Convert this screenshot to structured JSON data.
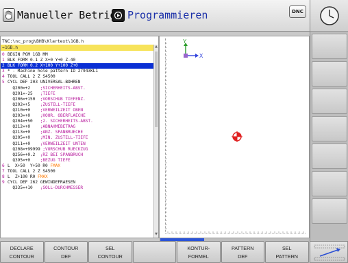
{
  "header": {
    "mode_left": "Manueller Betrieb",
    "mode_right": "Programmieren",
    "dnc_label": "DNC"
  },
  "program": {
    "path": "TNC:\\nc_prog\\BHB\\Klartext\\1GB.h",
    "file": "→1GB.h",
    "lines": [
      {
        "n": "0",
        "t": [
          {
            "c": "c",
            "s": "BEGIN PGM 1GB MM"
          }
        ]
      },
      {
        "n": "1",
        "t": [
          {
            "c": "c",
            "s": "BLK FORM 0.1 Z X+0 Y+0 Z-40"
          }
        ]
      },
      {
        "n": "2",
        "sel": true,
        "t": [
          {
            "c": "c",
            "s": "BLK FORM 0.2 X+100 Y+100 Z+0"
          }
        ]
      },
      {
        "n": "3",
        "t": [
          {
            "c": "c",
            "s": "* - Machine hole pattern ID 27943KL1"
          }
        ]
      },
      {
        "n": "4",
        "t": [
          {
            "c": "c",
            "s": "TOOL CALL 2 Z S4500"
          }
        ]
      },
      {
        "n": "5",
        "t": [
          {
            "c": "c",
            "s": "CYCL DEF 203 UNIVERSAL-BOHREN"
          }
        ]
      },
      {
        "n": "",
        "t": [
          {
            "c": "c",
            "s": "  Q200=+2    "
          },
          {
            "c": "p",
            "s": ";SICHERHEITS-ABST."
          }
        ]
      },
      {
        "n": "",
        "t": [
          {
            "c": "c",
            "s": "  Q201=-25   "
          },
          {
            "c": "p",
            "s": ";TIEFE"
          }
        ]
      },
      {
        "n": "",
        "t": [
          {
            "c": "c",
            "s": "  Q206=+150  "
          },
          {
            "c": "p",
            "s": ";VORSCHUB TIEFENZ."
          }
        ]
      },
      {
        "n": "",
        "t": [
          {
            "c": "c",
            "s": "  Q202=+5    "
          },
          {
            "c": "p",
            "s": ";ZUSTELL-TIEFE"
          }
        ]
      },
      {
        "n": "",
        "t": [
          {
            "c": "c",
            "s": "  Q210=+0    "
          },
          {
            "c": "p",
            "s": ";VERWEILZEIT OBEN"
          }
        ]
      },
      {
        "n": "",
        "t": [
          {
            "c": "c",
            "s": "  Q203=+0    "
          },
          {
            "c": "p",
            "s": ";KOOR. OBERFLAECHE"
          }
        ]
      },
      {
        "n": "",
        "t": [
          {
            "c": "c",
            "s": "  Q204=+50   "
          },
          {
            "c": "p",
            "s": ";2. SICHERHEITS-ABST."
          }
        ]
      },
      {
        "n": "",
        "t": [
          {
            "c": "c",
            "s": "  Q212=+0    "
          },
          {
            "c": "p",
            "s": ";ABNAHMEBETRAG"
          }
        ]
      },
      {
        "n": "",
        "t": [
          {
            "c": "c",
            "s": "  Q213=+0    "
          },
          {
            "c": "p",
            "s": ";ANZ. SPANBRUECHE"
          }
        ]
      },
      {
        "n": "",
        "t": [
          {
            "c": "c",
            "s": "  Q205=+0    "
          },
          {
            "c": "p",
            "s": ";MIN. ZUSTELL-TIEFE"
          }
        ]
      },
      {
        "n": "",
        "t": [
          {
            "c": "c",
            "s": "  Q211=+0    "
          },
          {
            "c": "p",
            "s": ";VERWEILZEIT UNTEN"
          }
        ]
      },
      {
        "n": "",
        "t": [
          {
            "c": "c",
            "s": "  Q208=+99999 "
          },
          {
            "c": "p",
            "s": ";VORSCHUB RUECKZUG"
          }
        ]
      },
      {
        "n": "",
        "t": [
          {
            "c": "c",
            "s": "  Q256=+0.2  "
          },
          {
            "c": "p",
            "s": ";RZ BEI SPANBRUCH"
          }
        ]
      },
      {
        "n": "",
        "t": [
          {
            "c": "c",
            "s": "  Q395=+0    "
          },
          {
            "c": "p",
            "s": ";BEZUG TIEFE"
          }
        ]
      },
      {
        "n": "6",
        "t": [
          {
            "c": "c",
            "s": "L  X+50  Y+50 R0 "
          },
          {
            "c": "o",
            "s": "FMAX"
          }
        ]
      },
      {
        "n": "7",
        "t": [
          {
            "c": "c",
            "s": "TOOL CALL 2 Z S4500"
          }
        ]
      },
      {
        "n": "8",
        "t": [
          {
            "c": "c",
            "s": "L  Z+100 R0 "
          },
          {
            "c": "o",
            "s": "FMAX"
          }
        ]
      },
      {
        "n": "9",
        "t": [
          {
            "c": "c",
            "s": "CYCL DEF 262 GEWINDEFRAESEN"
          }
        ]
      },
      {
        "n": "",
        "t": [
          {
            "c": "c",
            "s": "  Q335=+10   "
          },
          {
            "c": "p",
            "s": ";SOLL-DURCHMESSER"
          }
        ]
      }
    ]
  },
  "graphics": {
    "axis_y": "Y",
    "axis_x": "X",
    "axis_y_color": "#2a9d2a",
    "axis_x_color": "#3344dd",
    "target_color": "#e02020"
  },
  "softkeys": [
    {
      "l1": "DECLARE",
      "l2": "CONTOUR"
    },
    {
      "l1": "CONTOUR",
      "l2": "DEF"
    },
    {
      "l1": "SEL",
      "l2": "CONTOUR"
    },
    {
      "l1": "",
      "l2": ""
    },
    {
      "l1": "KONTUR-",
      "l2": "FORMEL"
    },
    {
      "l1": "PATTERN",
      "l2": "DEF"
    },
    {
      "l1": "SEL",
      "l2": "PATTERN"
    }
  ],
  "colors": {
    "selection": "#0a2fd4",
    "file_bar": "#f7e35a",
    "numbers": "#b5159a"
  }
}
